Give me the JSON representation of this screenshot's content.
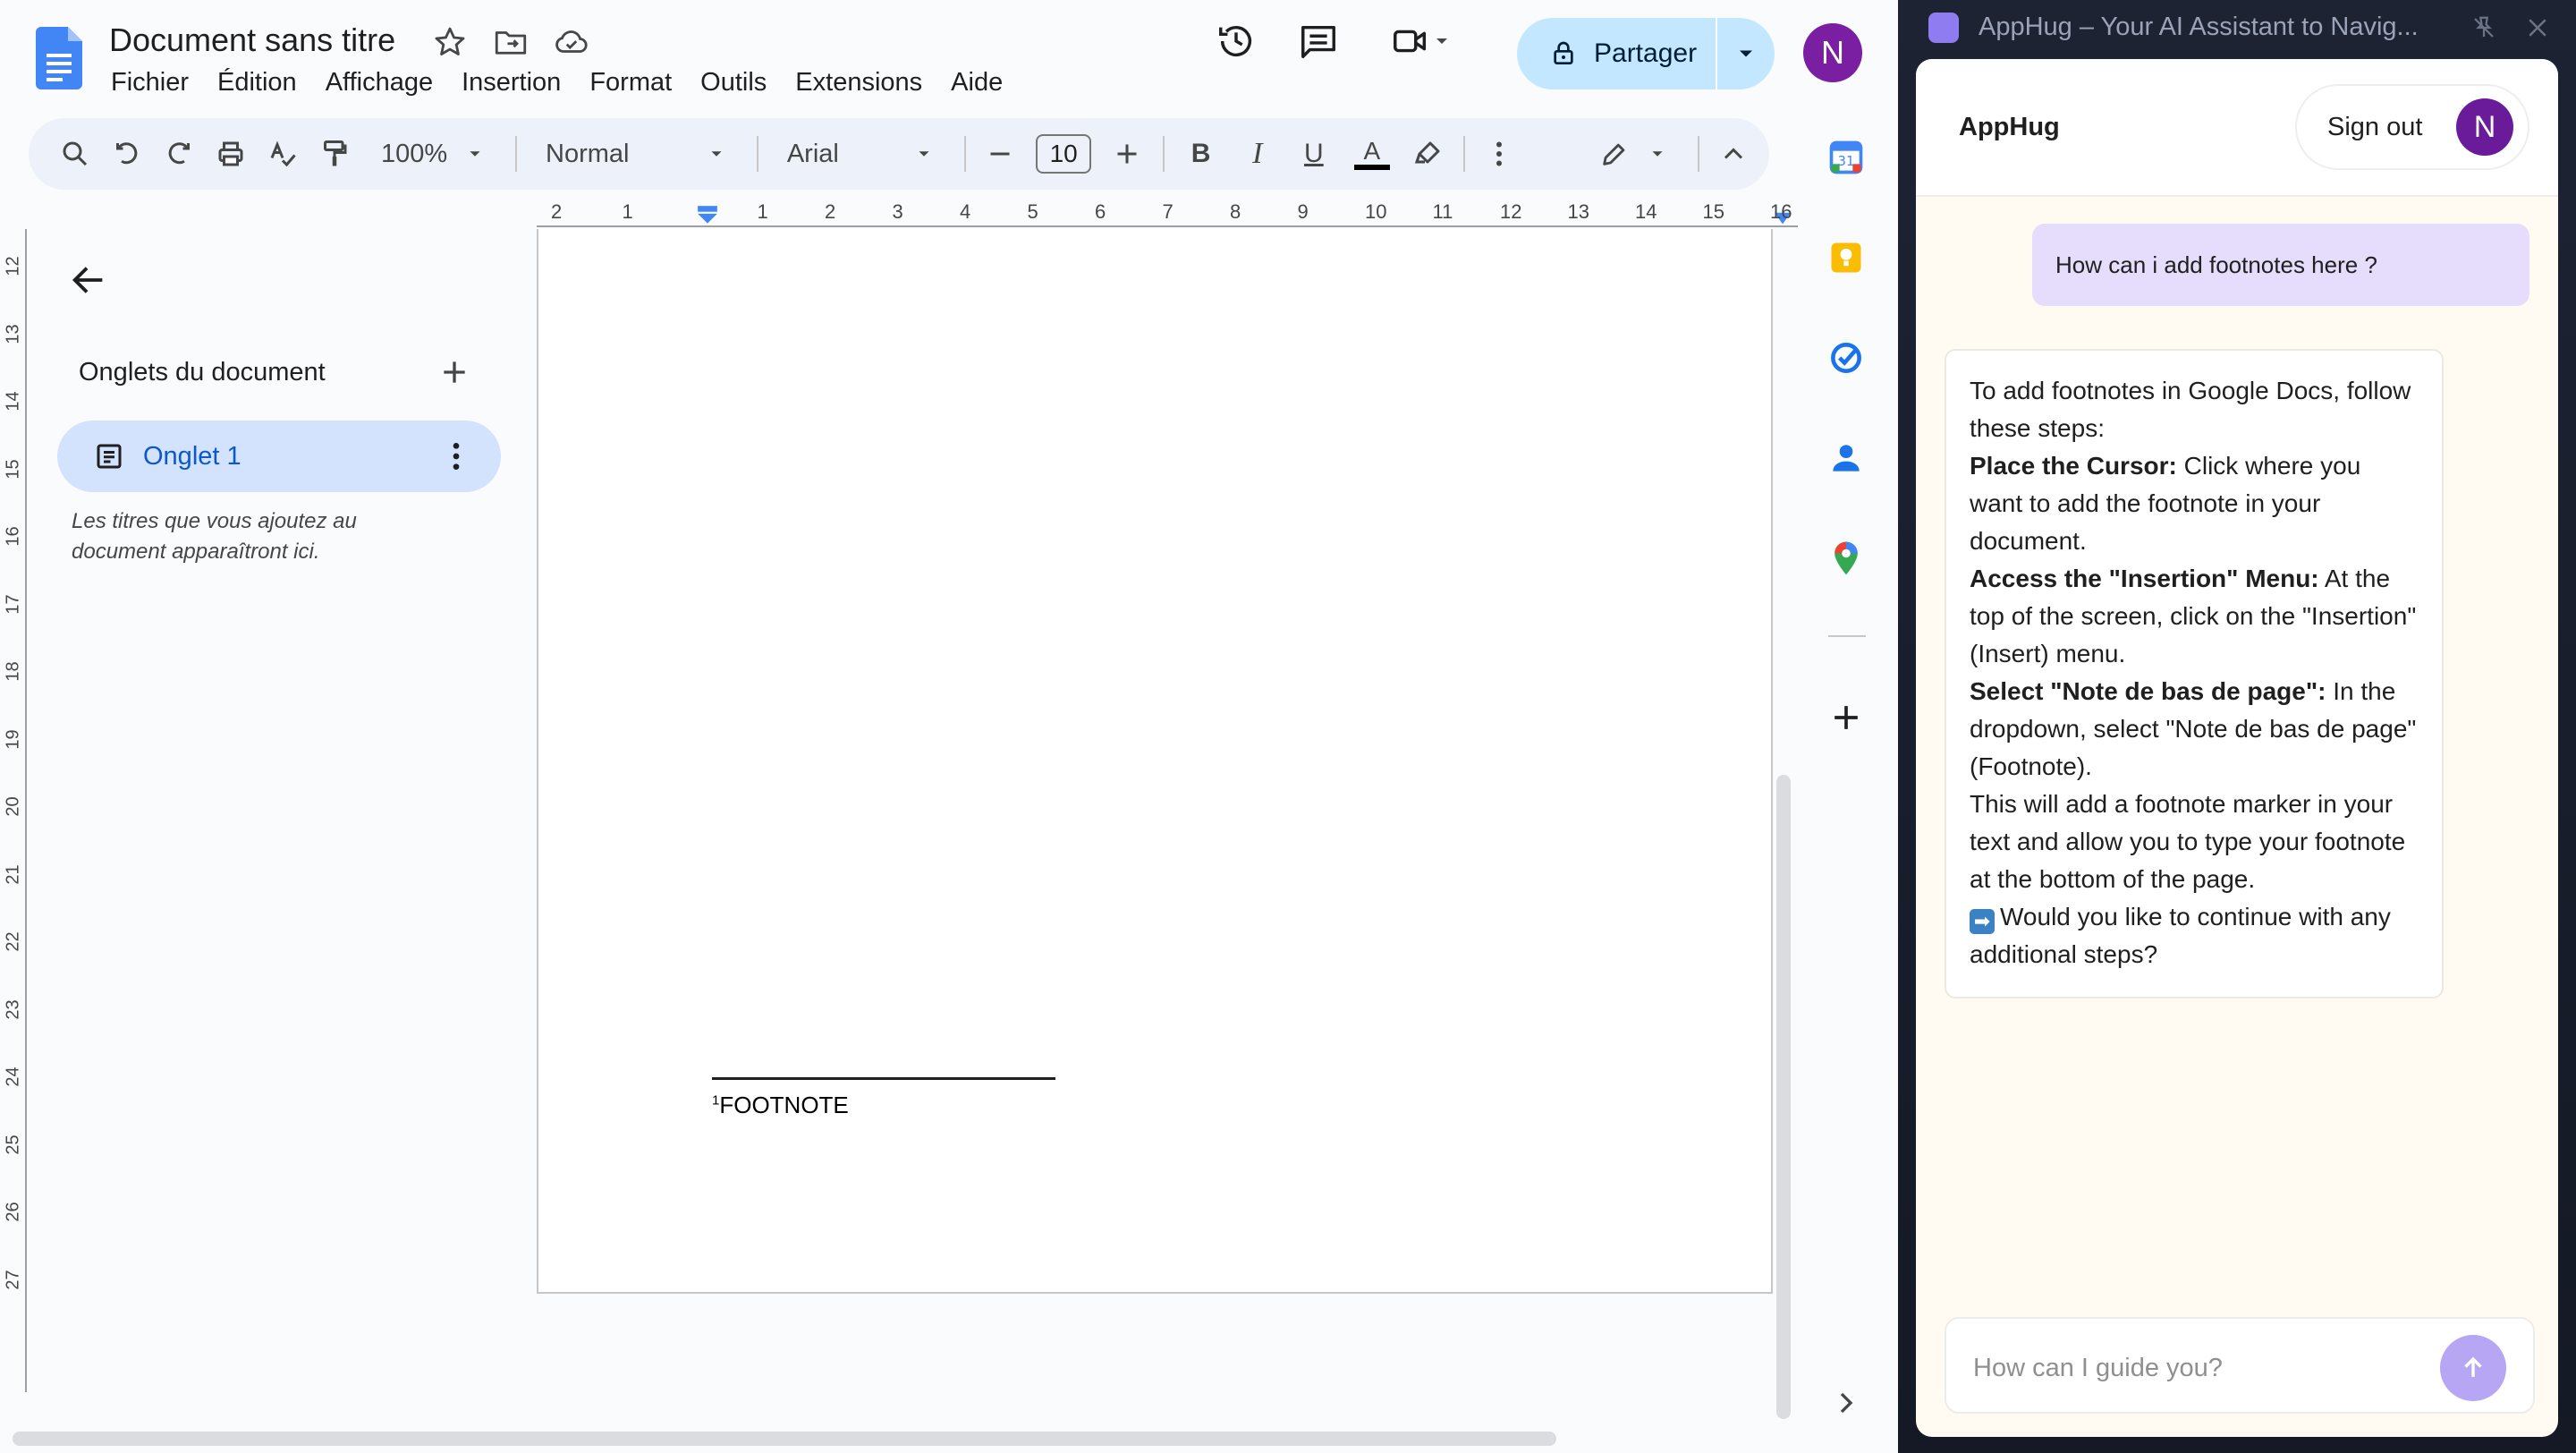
{
  "docs": {
    "title": "Document sans titre",
    "menu": [
      "Fichier",
      "Édition",
      "Affichage",
      "Insertion",
      "Format",
      "Outils",
      "Extensions",
      "Aide"
    ],
    "share_label": "Partager",
    "avatar_letter": "N",
    "toolbar": {
      "zoom": "100%",
      "style": "Normal",
      "font": "Arial",
      "font_size": "10",
      "bold": "B",
      "italic": "I",
      "underline": "U",
      "text_color": "A"
    },
    "ruler_h": [
      "2",
      "1",
      "1",
      "2",
      "3",
      "4",
      "5",
      "6",
      "7",
      "8",
      "9",
      "10",
      "11",
      "12",
      "13",
      "14",
      "15",
      "16"
    ],
    "ruler_v": [
      "12",
      "13",
      "14",
      "15",
      "16",
      "17",
      "18",
      "19",
      "20",
      "21",
      "22",
      "23",
      "24",
      "25",
      "26",
      "27"
    ],
    "outline": {
      "heading": "Onglets du document",
      "tab_label": "Onglet 1",
      "hint": "Les titres que vous ajoutez au document apparaîtront ici."
    },
    "footnote": {
      "marker": "1",
      "text": "FOOTNOTE"
    }
  },
  "apphug": {
    "window_title": "AppHug – Your AI Assistant to Navig...",
    "brand": "AppHug",
    "signout_label": "Sign out",
    "avatar_letter": "N",
    "user_message": "How can i add footnotes here ?",
    "bot": {
      "intro": "To add footnotes in Google Docs, follow these steps:",
      "step1_title": "Place the Cursor:",
      "step1_text": " Click where you want to add the footnote in your document.",
      "step2_title": "Access the \"Insertion\" Menu:",
      "step2_text": " At the top of the screen, click on the \"Insertion\" (Insert) menu.",
      "step3_title": "Select \"Note de bas de page\":",
      "step3_text": " In the dropdown, select \"Note de bas de page\" (Footnote).",
      "outro": "This will add a footnote marker in your text and allow you to type your footnote at the bottom of the page.",
      "arrow_glyph": "➡",
      "question": "Would you like to continue with any additional steps?"
    },
    "input_placeholder": "How can I guide you?"
  },
  "colors": {
    "docs_blue": "#0b57d0",
    "share_bg": "#c2e7ff",
    "tab_active_bg": "#d3e3fd",
    "avatar_purple": "#7b1fa2",
    "apphug_user_bubble": "#e6dcfb",
    "apphug_send": "#b7a6f4"
  }
}
